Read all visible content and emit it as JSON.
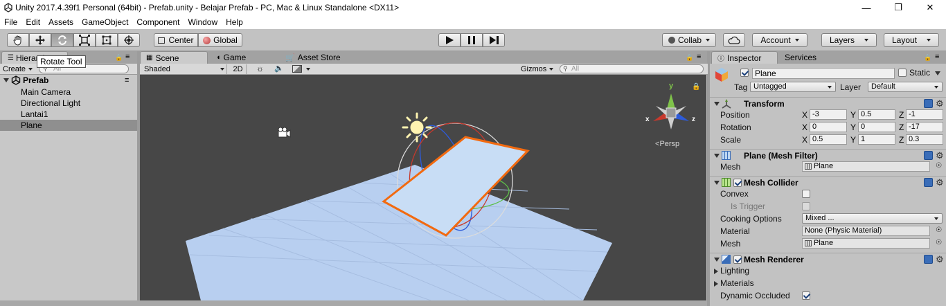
{
  "window": {
    "title": "Unity 2017.4.39f1 Personal (64bit) - Prefab.unity - Belajar Prefab - PC, Mac & Linux Standalone <DX11>"
  },
  "menu": [
    "File",
    "Edit",
    "Assets",
    "GameObject",
    "Component",
    "Window",
    "Help"
  ],
  "toolbar": {
    "pivot_label": "Center",
    "space_label": "Global",
    "collab_label": "Collab",
    "account_label": "Account",
    "layers_label": "Layers",
    "layout_label": "Layout",
    "tooltip": "Rotate Tool",
    "active_tool": "rotate"
  },
  "hierarchy": {
    "tab_label": "Hierarchy",
    "create_label": "Create",
    "search_placeholder": "All",
    "scene_name": "Prefab",
    "items": [
      "Main Camera",
      "Directional Light",
      "Lantai1",
      "Plane"
    ],
    "selected": "Plane"
  },
  "scene": {
    "tabs": [
      "Scene",
      "Game",
      "Asset Store"
    ],
    "active_tab": "Scene",
    "shading": "Shaded",
    "mode_2d": "2D",
    "gizmos_label": "Gizmos",
    "search_placeholder": "All",
    "persp_label": "Persp",
    "axes": {
      "x": "x",
      "y": "y",
      "z": "z"
    }
  },
  "inspector": {
    "tabs": [
      "Inspector",
      "Services"
    ],
    "object_name": "Plane",
    "static_label": "Static",
    "tag_label": "Tag",
    "tag_value": "Untagged",
    "layer_label": "Layer",
    "layer_value": "Default",
    "transform": {
      "title": "Transform",
      "rows": [
        {
          "label": "Position",
          "x": "-3",
          "y": "0.5",
          "z": "-1"
        },
        {
          "label": "Rotation",
          "x": "0",
          "y": "0",
          "z": "-17"
        },
        {
          "label": "Scale",
          "x": "0.5",
          "y": "1",
          "z": "0.3"
        }
      ]
    },
    "mesh_filter": {
      "title": "Plane (Mesh Filter)",
      "mesh_label": "Mesh",
      "mesh_value": "Plane"
    },
    "mesh_collider": {
      "title": "Mesh Collider",
      "convex_label": "Convex",
      "trigger_label": "Is Trigger",
      "cooking_label": "Cooking Options",
      "cooking_value": "Mixed ...",
      "material_label": "Material",
      "material_value": "None (Physic Material)",
      "mesh_label": "Mesh",
      "mesh_value": "Plane"
    },
    "mesh_renderer": {
      "title": "Mesh Renderer",
      "lighting_label": "Lighting",
      "materials_label": "Materials",
      "occluded_label": "Dynamic Occluded"
    }
  },
  "colors": {
    "selection_outline": "#f26a10",
    "plane_fill": "#c8ddf5",
    "scene_bg": "#474747"
  }
}
